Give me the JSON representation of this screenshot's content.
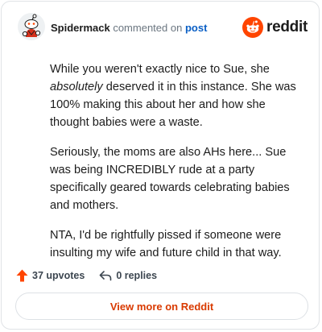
{
  "header": {
    "username": "Spidermack",
    "action_text": "commented on",
    "post_link": "post",
    "logo_text": "reddit"
  },
  "comment": {
    "paragraph1_before": "While you weren't exactly nice to Sue, she ",
    "paragraph1_emphasis": "absolutely",
    "paragraph1_after": " deserved it in this instance. She was 100% making this about her and how she thought babies were a waste.",
    "paragraph2": "Seriously, the moms are also AHs here... Sue was being INCREDIBLY rude at a party specifically geared towards celebrating babies and mothers.",
    "paragraph3": "NTA, I'd be rightfully pissed if someone were insulting my wife and future child in that way."
  },
  "footer": {
    "upvotes_label": "37 upvotes",
    "replies_label": "0 replies"
  },
  "view_more_label": "View more on Reddit",
  "colors": {
    "brand": "#ff4500",
    "link": "#0a5fc5",
    "button_text": "#d93a00"
  },
  "icons": {
    "avatar": "snoo-avatar",
    "logo": "reddit-logo-icon",
    "upvote": "upvote-arrow-icon",
    "reply": "reply-arrow-icon"
  }
}
